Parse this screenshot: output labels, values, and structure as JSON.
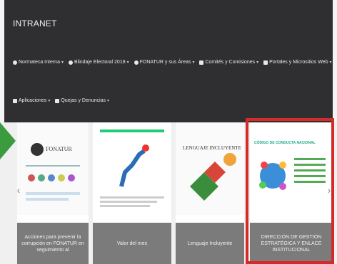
{
  "navbar": {
    "brand": "INTRANET",
    "row1": [
      {
        "label": "Normateca Interna",
        "icon": "circle-icon"
      },
      {
        "label": "Blindaje Electoral 2018",
        "icon": "circle-icon"
      },
      {
        "label": "FONATUR y sus Áreas",
        "icon": "globe-icon"
      },
      {
        "label": "Comités y Comisiones",
        "icon": "people-icon"
      },
      {
        "label": "Portales y Micrositios Web",
        "icon": "home-icon"
      }
    ],
    "row2": [
      {
        "label": "Aplicaciones",
        "icon": "grid-icon"
      },
      {
        "label": "Quejas y Denuncias",
        "icon": "megaphone-icon"
      }
    ],
    "caret": "▾"
  },
  "carousel": {
    "cards": [
      {
        "caption": "Acciones para prevenir la corrupción en FONATUR en seguimiento al",
        "image_heading": "FONATUR"
      },
      {
        "caption": "Valor del mes",
        "image_heading": ""
      },
      {
        "caption": "Lenguaje Incluyente",
        "image_heading": "LENGUAJE INCLUYENTE"
      },
      {
        "caption": "DIRECCIÓN DE GESTIÓN ESTRATÉGICA Y ENLACE INSTITUCIONAL",
        "image_heading": "CÓDIGO DE CONDUCTA NACIONAL"
      }
    ],
    "prev": "‹",
    "next": "›"
  },
  "colors": {
    "navbar": "#2f2f31",
    "caption": "#7b7b7b",
    "highlight": "#d52a2a",
    "arrow": "#3c9a3f"
  }
}
